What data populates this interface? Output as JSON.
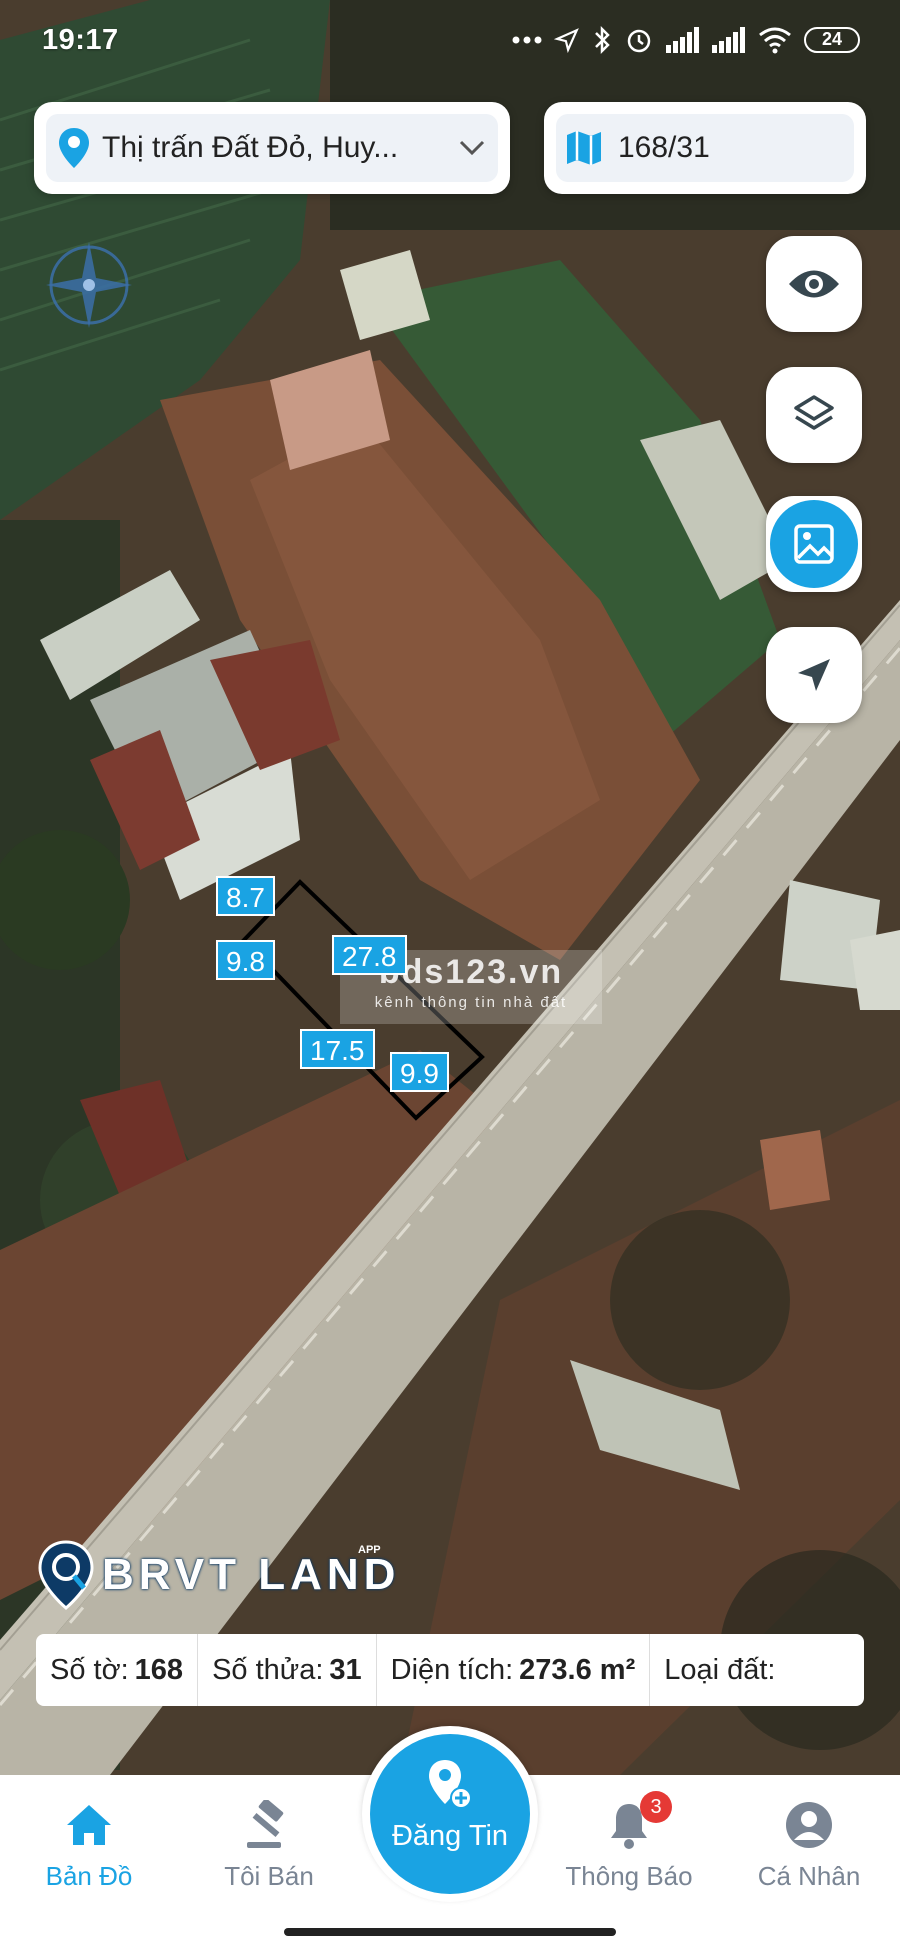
{
  "status_bar": {
    "time": "19:17",
    "battery": "24",
    "icons": [
      "more-dots-icon",
      "location-arrow-icon",
      "bluetooth-icon",
      "alarm-icon",
      "signal-icon",
      "signal-icon",
      "wifi-icon",
      "battery-icon"
    ]
  },
  "search": {
    "location": "Thị trấn Đất Đỏ, Huy...",
    "parcel": "168/31"
  },
  "map_controls": [
    "eye-icon",
    "layers-icon",
    "image-icon",
    "locate-icon"
  ],
  "parcel": {
    "dimensions": {
      "top": "8.7",
      "left": "9.8",
      "long_side": "27.8",
      "bottom": "17.5",
      "right": "9.9"
    }
  },
  "watermark": {
    "title": "bds123.vn",
    "subtitle": "kênh thông tin nhà đất"
  },
  "brand": {
    "name": "BRVT LAND",
    "tag": "APP"
  },
  "info_bar": {
    "sheet_label": "Số tờ:",
    "sheet_value": "168",
    "plot_label": "Số thửa:",
    "plot_value": "31",
    "area_label": "Diện tích:",
    "area_value": "273.6 m²",
    "landtype_label": "Loại đất:"
  },
  "nav": {
    "home": "Bản Đồ",
    "sell": "Tôi Bán",
    "post": "Đăng Tin",
    "notifications": "Thông Báo",
    "notification_count": "3",
    "profile": "Cá Nhân"
  },
  "colors": {
    "accent": "#1aa3e3",
    "badge": "#e53935"
  }
}
